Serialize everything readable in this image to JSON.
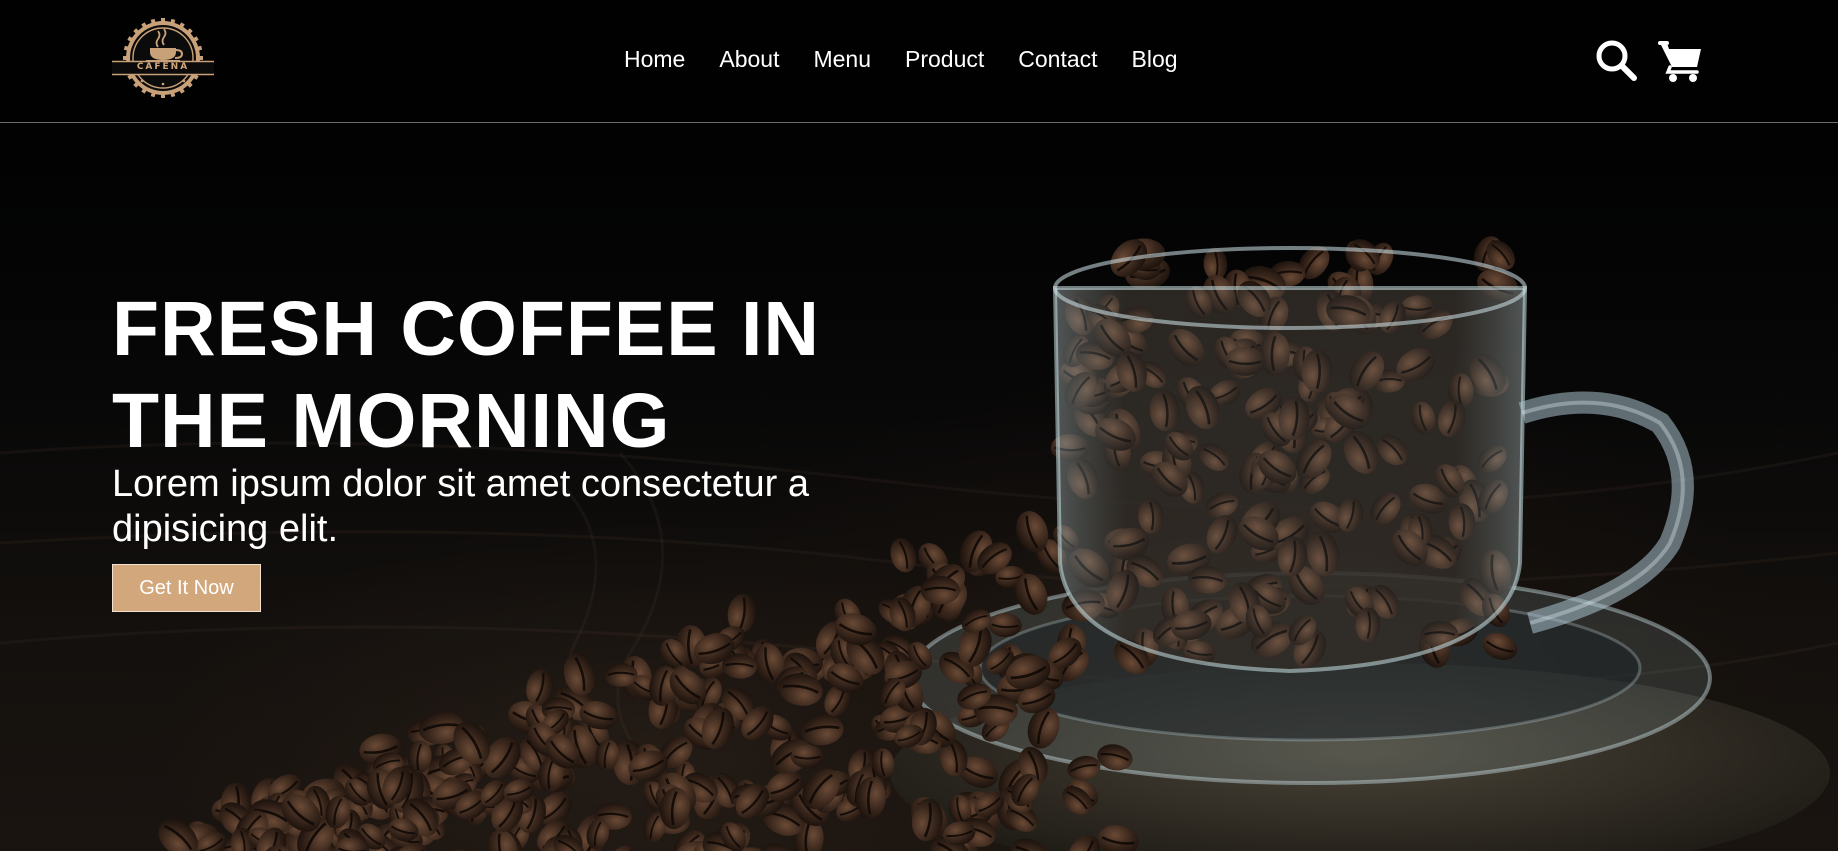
{
  "brand": {
    "logo_text": "CAFENA",
    "accent_color": "#d3a77c"
  },
  "nav": {
    "items": [
      {
        "label": "Home"
      },
      {
        "label": "About"
      },
      {
        "label": "Menu"
      },
      {
        "label": "Product"
      },
      {
        "label": "Contact"
      },
      {
        "label": "Blog"
      }
    ]
  },
  "header_icons": {
    "search": "search-icon",
    "cart": "shopping-cart-icon"
  },
  "hero": {
    "title": "FRESH COFFEE IN THE MORNING",
    "subtitle": "Lorem ipsum dolor sit amet consectetur a dipisicing elit.",
    "cta_label": "Get It Now",
    "background_image": "coffee-beans-in-glass-cup"
  }
}
